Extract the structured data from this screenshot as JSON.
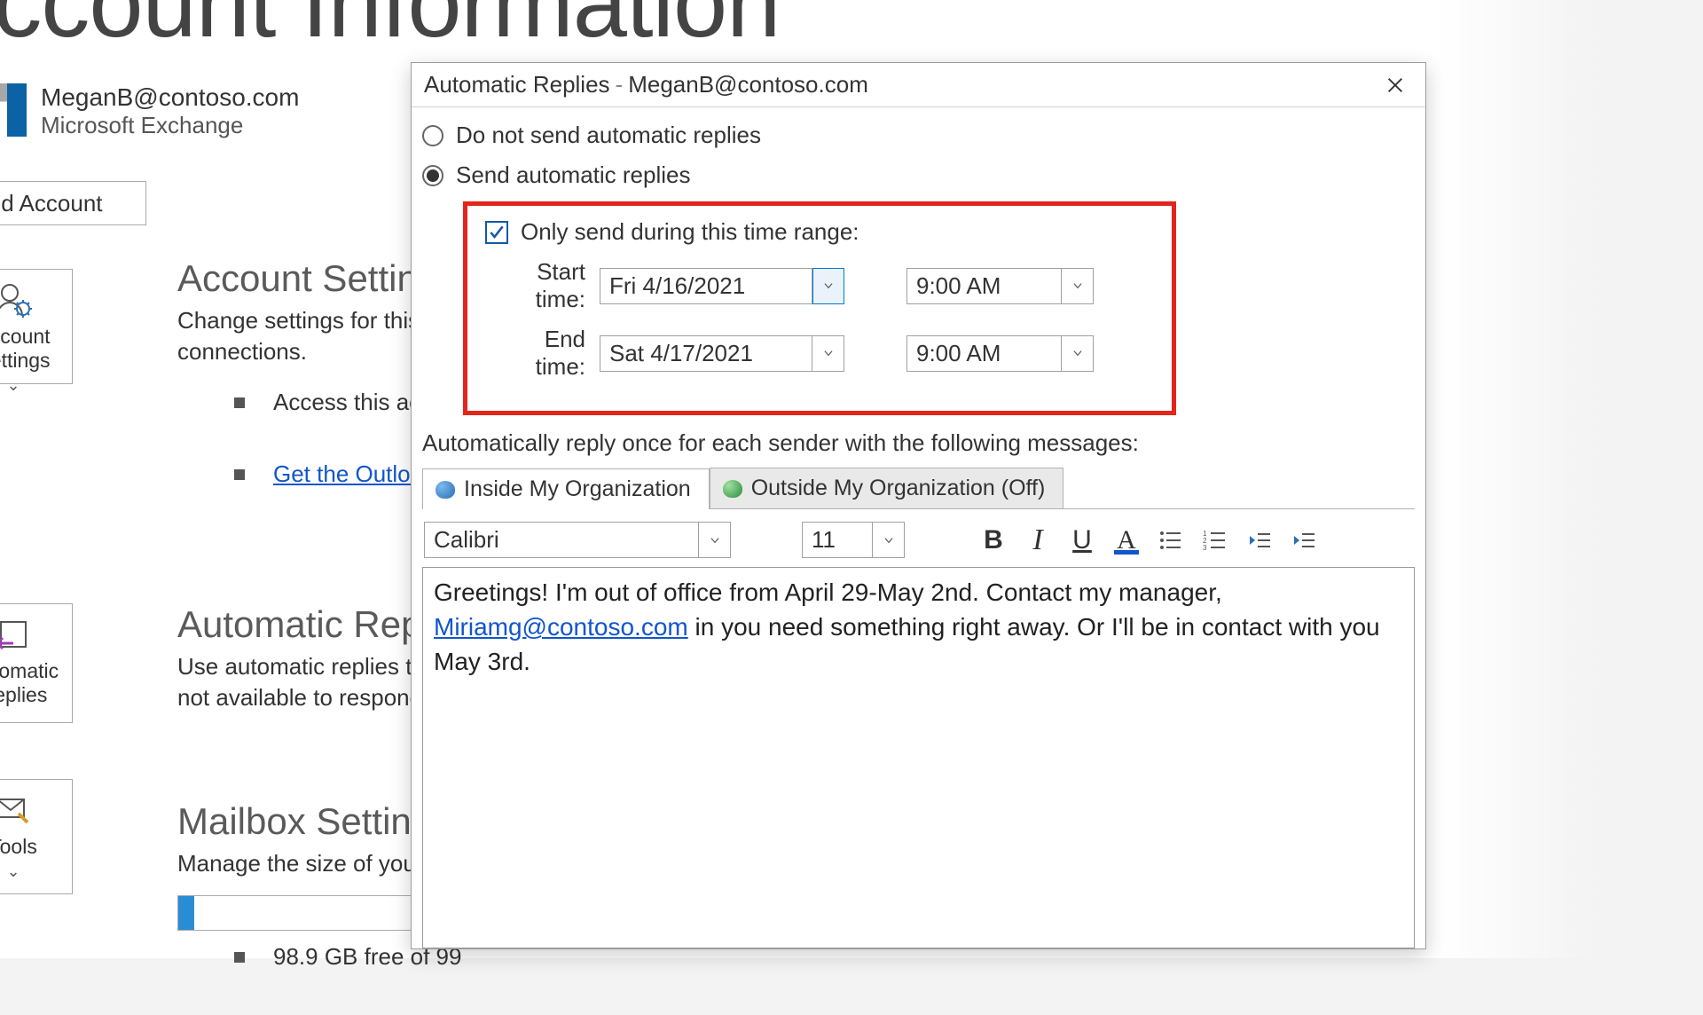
{
  "page": {
    "title": "Account Information",
    "account_email": "MeganB@contoso.com",
    "account_type": "Microsoft Exchange",
    "add_account_label": "Add Account",
    "sidebar": {
      "account_settings_label": "Account Settings",
      "automatic_replies_label": "Automatic Replies",
      "tools_label": "Tools"
    },
    "section_account_settings": {
      "title": "Account Settings",
      "desc": "Change settings for this account or set up more connections.",
      "bullet1": "Access this account",
      "bullet2_link": "Get the Outlook app"
    },
    "section_auto": {
      "title": "Automatic Replies",
      "desc": "Use automatic replies to notify others that you are not available to respond."
    },
    "section_mailbox": {
      "title": "Mailbox Settings",
      "desc": "Manage the size of your",
      "storage_text": "98.9 GB free of 99"
    }
  },
  "dialog": {
    "title": "Automatic Replies",
    "title_email": "MeganB@contoso.com",
    "radio_off": "Do not send automatic replies",
    "radio_on": "Send automatic replies",
    "checkbox_label": "Only send during this time range:",
    "start_label": "Start time:",
    "end_label": "End time:",
    "start_date": "Fri 4/16/2021",
    "start_time": "9:00 AM",
    "end_date": "Sat 4/17/2021",
    "end_time": "9:00 AM",
    "instruction": "Automatically reply once for each sender with the following messages:",
    "tab_inside": "Inside My Organization",
    "tab_outside": "Outside My Organization (Off)",
    "font_name": "Calibri",
    "font_size": "11",
    "message": {
      "part1": "Greetings! I'm out of office from April 29-May 2nd. Contact my manager, ",
      "link": "Miriamg@contoso.com",
      "part2": " in you need something right away. Or I'll be in contact with you May 3rd."
    }
  }
}
